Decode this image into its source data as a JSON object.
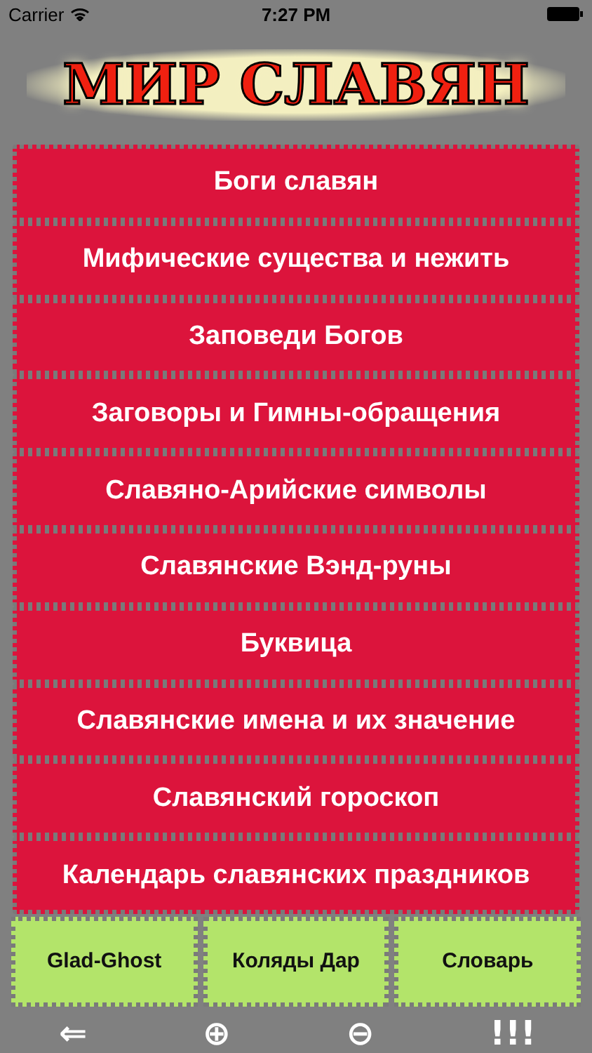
{
  "status_bar": {
    "carrier": "Carrier",
    "time": "7:27 PM"
  },
  "title": "МИР СЛАВЯН",
  "menu": [
    {
      "label": "Боги славян"
    },
    {
      "label": "Мифические существа и нежить"
    },
    {
      "label": "Заповеди Богов"
    },
    {
      "label": "Заговоры и Гимны-обращения"
    },
    {
      "label": "Славяно-Арийские символы"
    },
    {
      "label": "Славянские Вэнд-руны"
    },
    {
      "label": "Буквица"
    },
    {
      "label": "Славянские имена и их значение"
    },
    {
      "label": "Славянский гороскоп"
    },
    {
      "label": "Календарь славянских праздников"
    }
  ],
  "bottom_buttons": [
    {
      "label": "Glad-Ghost"
    },
    {
      "label": "Коляды Дар"
    },
    {
      "label": "Словарь"
    }
  ],
  "toolbar": [
    {
      "label": "⇐"
    },
    {
      "label": "⊕"
    },
    {
      "label": "⊖"
    },
    {
      "label": "!!!"
    }
  ]
}
